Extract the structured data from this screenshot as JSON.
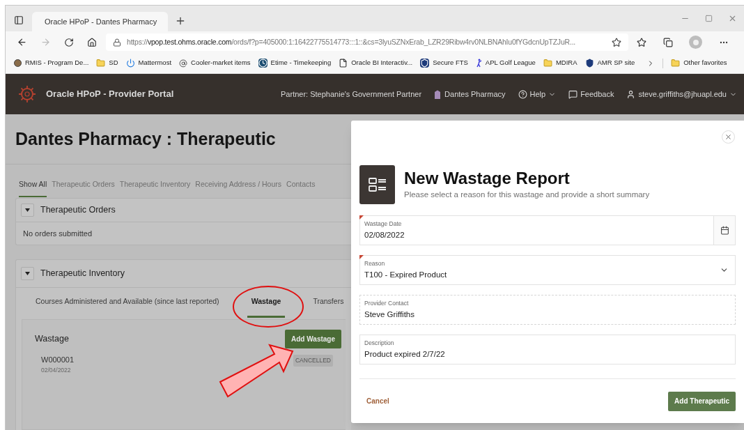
{
  "browser": {
    "tab_title": "Oracle HPoP - Dantes Pharmacy",
    "url_scheme": "https://",
    "url_host": "vpop.test.ohms.oracle.com",
    "url_rest": "/ords/f?p=405000:1:16422775514773:::1::&cs=3lyuSZNxErab_LZR29Ribw4rv0NLBNAhIu0fYGdcnUpTZJuR...",
    "bookmarks": [
      {
        "label": "RMIS - Program De...",
        "kind": "seal"
      },
      {
        "label": "SD",
        "kind": "folder"
      },
      {
        "label": "Mattermost",
        "kind": "power"
      },
      {
        "label": "Cooler-market items",
        "kind": "at"
      },
      {
        "label": "Etime - Timekeeping",
        "kind": "clock"
      },
      {
        "label": "Oracle BI Interactiv...",
        "kind": "page"
      },
      {
        "label": "Secure FTS",
        "kind": "badge"
      },
      {
        "label": "APL Golf League",
        "kind": "golfer"
      },
      {
        "label": "MDIRA",
        "kind": "folder"
      },
      {
        "label": "AMR SP site",
        "kind": "shield"
      }
    ],
    "other_favorites": "Other favorites"
  },
  "header": {
    "app_title": "Oracle HPoP - Provider Portal",
    "partner": "Partner: Stephanie's Government Partner",
    "pharmacy": "Dantes Pharmacy",
    "help": "Help",
    "feedback": "Feedback",
    "user": "steve.griffiths@jhuapl.edu"
  },
  "page": {
    "title": "Dantes Pharmacy : Therapeutic",
    "tabs": [
      {
        "label": "Show All",
        "selected": true
      },
      {
        "label": "Therapeutic Orders",
        "selected": false
      },
      {
        "label": "Therapeutic Inventory",
        "selected": false
      },
      {
        "label": "Receiving Address / Hours",
        "selected": false
      },
      {
        "label": "Contacts",
        "selected": false
      }
    ],
    "orders": {
      "title": "Therapeutic Orders",
      "empty_text": "No orders submitted"
    },
    "inventory": {
      "title": "Therapeutic Inventory",
      "subtabs": [
        {
          "label": "Courses Administered and Available (since last reported)",
          "selected": false
        },
        {
          "label": "Wastage",
          "selected": true
        },
        {
          "label": "Transfers",
          "selected": false
        }
      ],
      "wastage_title": "Wastage",
      "add_button": "Add Wastage",
      "items": [
        {
          "id": "W000001",
          "date": "02/04/2022",
          "status": "CANCELLED"
        }
      ]
    }
  },
  "modal": {
    "title": "New Wastage Report",
    "subtitle": "Please select a reason for this wastage and provide a short summary",
    "fields": [
      {
        "label": "Wastage Date",
        "value": "02/08/2022",
        "kind": "date",
        "required": true
      },
      {
        "label": "Reason",
        "value": "T100 - Expired Product",
        "kind": "select",
        "required": true
      },
      {
        "label": "Provider Contact",
        "value": "Steve Griffiths",
        "kind": "display",
        "required": false
      },
      {
        "label": "Description",
        "value": "Product expired 2/7/22",
        "kind": "text",
        "required": false
      }
    ],
    "cancel": "Cancel",
    "submit": "Add Therapeutic"
  }
}
